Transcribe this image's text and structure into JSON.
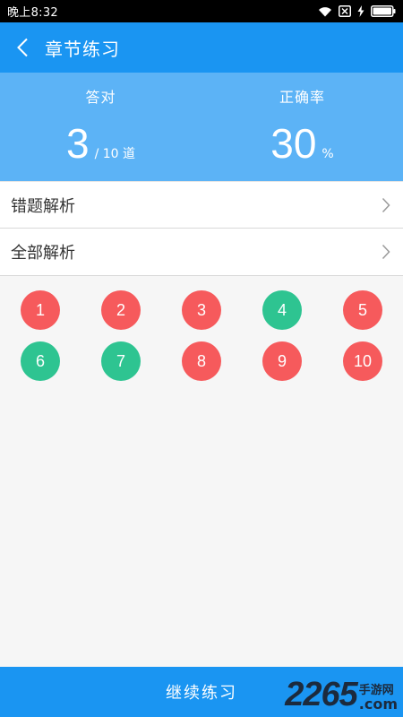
{
  "status_bar": {
    "time": "晚上8:32",
    "icons": [
      "wifi-icon",
      "notification-x-icon",
      "charging-icon",
      "battery-icon"
    ]
  },
  "nav": {
    "title": "章节练习",
    "back_icon": "chevron-left-icon"
  },
  "summary": {
    "correct_label": "答对",
    "correct_value": "3",
    "correct_total": "/ 10 道",
    "accuracy_label": "正确率",
    "accuracy_value": "30",
    "accuracy_unit": "%"
  },
  "menu": {
    "items": [
      {
        "label": "错题解析"
      },
      {
        "label": "全部解析"
      }
    ]
  },
  "questions": [
    {
      "number": "1",
      "status": "wrong"
    },
    {
      "number": "2",
      "status": "wrong"
    },
    {
      "number": "3",
      "status": "wrong"
    },
    {
      "number": "4",
      "status": "correct"
    },
    {
      "number": "5",
      "status": "wrong"
    },
    {
      "number": "6",
      "status": "correct"
    },
    {
      "number": "7",
      "status": "correct"
    },
    {
      "number": "8",
      "status": "wrong"
    },
    {
      "number": "9",
      "status": "wrong"
    },
    {
      "number": "10",
      "status": "wrong"
    }
  ],
  "colors": {
    "primary": "#1a95f2",
    "summary_bg": "#5cb3f6",
    "correct": "#2ec491",
    "wrong": "#f65a5c"
  },
  "bottom": {
    "continue_label": "继续练习"
  },
  "watermark": {
    "number": "2265",
    "site_cn": "手游网",
    "domain": ".com"
  }
}
